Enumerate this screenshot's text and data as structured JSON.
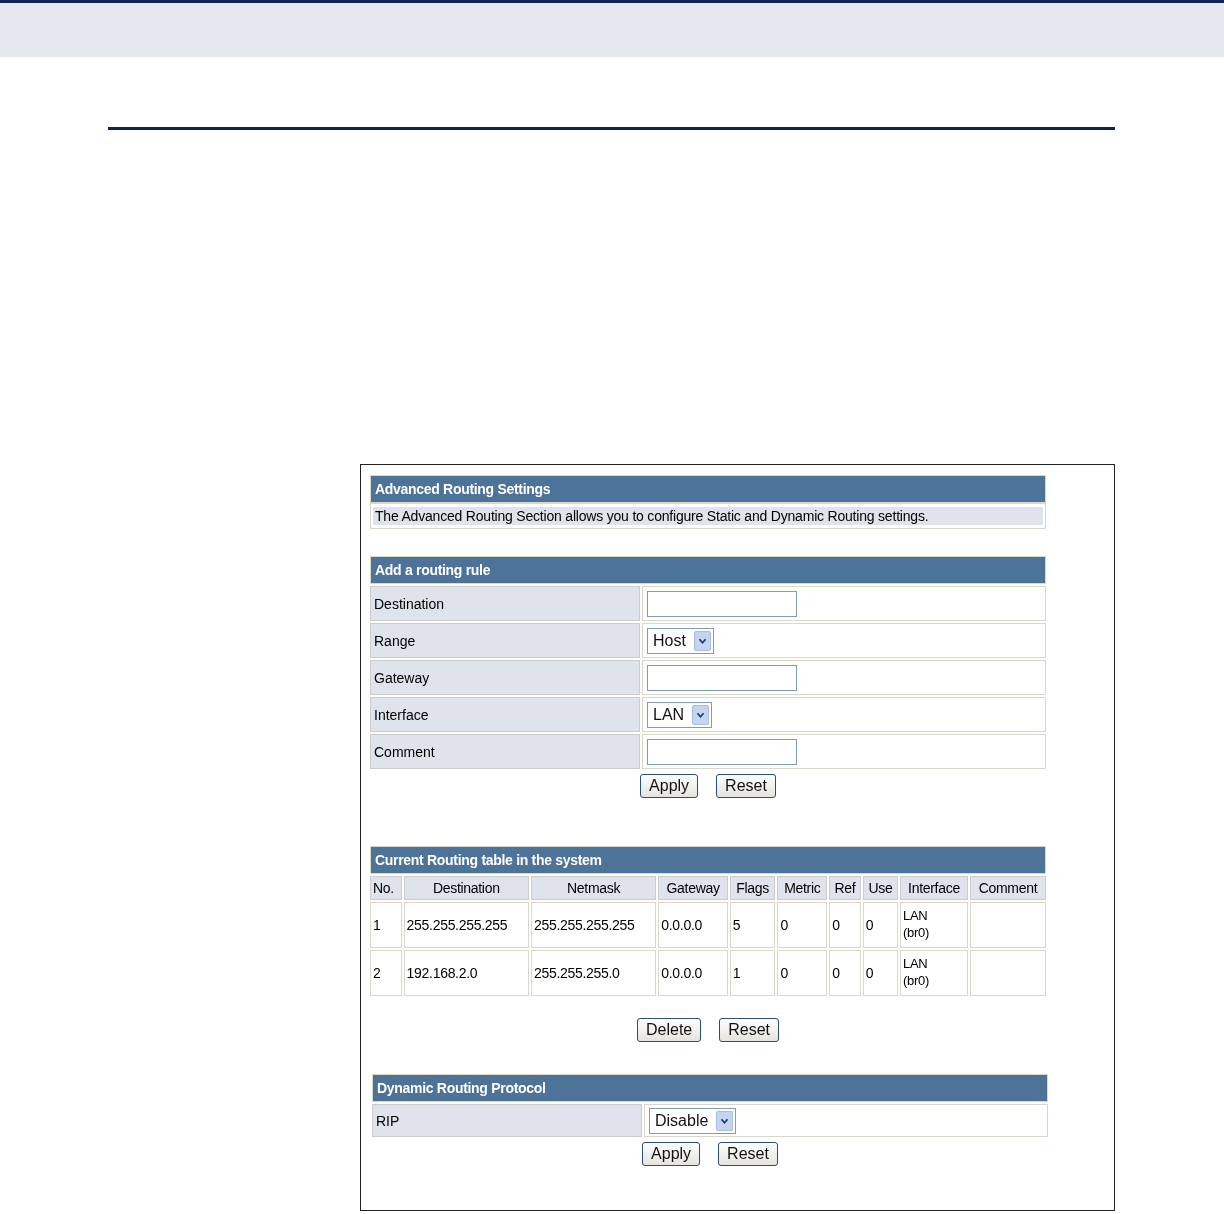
{
  "settings": {
    "title": "Advanced Routing Settings",
    "description": "The Advanced Routing Section allows you to configure Static and Dynamic Routing settings."
  },
  "add_rule": {
    "title": "Add a routing rule",
    "fields": [
      {
        "label": "Destination",
        "kind": "text"
      },
      {
        "label": "Range",
        "kind": "select",
        "value": "Host"
      },
      {
        "label": "Gateway",
        "kind": "text"
      },
      {
        "label": "Interface",
        "kind": "select",
        "value": "LAN"
      },
      {
        "label": "Comment",
        "kind": "text"
      }
    ],
    "buttons": [
      "Apply",
      "Reset"
    ]
  },
  "routing_table": {
    "title": "Current Routing table in the system",
    "columns": [
      "No.",
      "Destination",
      "Netmask",
      "Gateway",
      "Flags",
      "Metric",
      "Ref",
      "Use",
      "Interface",
      "Comment"
    ],
    "rows": [
      {
        "cells": [
          "1",
          "255.255.255.255",
          "255.255.255.255",
          "0.0.0.0",
          "5",
          "0",
          "0",
          "0",
          "LAN\n(br0)",
          ""
        ]
      },
      {
        "cells": [
          "2",
          "192.168.2.0",
          "255.255.255.0",
          "0.0.0.0",
          "1",
          "0",
          "0",
          "0",
          "LAN\n(br0)",
          ""
        ]
      }
    ],
    "buttons": [
      "Delete",
      "Reset"
    ]
  },
  "dynamic_routing": {
    "title": "Dynamic Routing Protocol",
    "fields": [
      {
        "label": "RIP",
        "kind": "select",
        "value": "Disable"
      }
    ],
    "buttons": [
      "Apply",
      "Reset"
    ]
  }
}
